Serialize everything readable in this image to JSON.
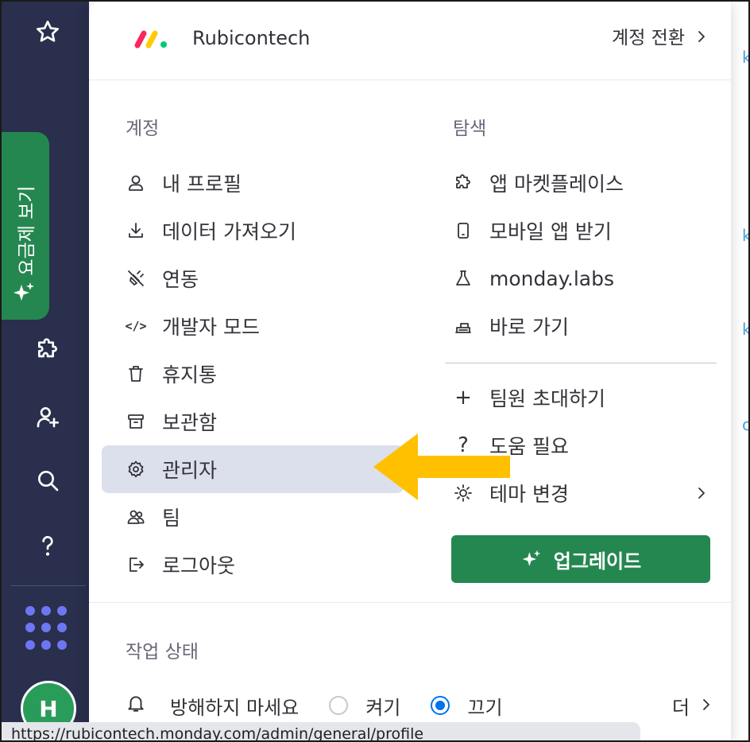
{
  "rail": {
    "plan_label": "요금제 보기",
    "avatar_initial": "H",
    "icons": [
      "star-icon",
      "puzzle-icon",
      "add-user-icon",
      "search-icon",
      "help-icon",
      "apps-grid-icon"
    ]
  },
  "header": {
    "account_name": "Rubicontech",
    "switch_account": "계정 전환"
  },
  "account_section": {
    "title": "계정",
    "items": [
      {
        "label": "내 프로필",
        "icon": "user-icon"
      },
      {
        "label": "데이터 가져오기",
        "icon": "download-icon"
      },
      {
        "label": "연동",
        "icon": "plug-icon"
      },
      {
        "label": "개발자 모드",
        "icon": "code-icon"
      },
      {
        "label": "휴지통",
        "icon": "trash-icon"
      },
      {
        "label": "보관함",
        "icon": "archive-icon"
      },
      {
        "label": "관리자",
        "icon": "gear-icon",
        "active": true
      },
      {
        "label": "팀",
        "icon": "team-icon"
      },
      {
        "label": "로그아웃",
        "icon": "logout-icon"
      }
    ]
  },
  "explore_section": {
    "title": "탐색",
    "items": [
      {
        "label": "앱 마켓플레이스",
        "icon": "puzzle-icon"
      },
      {
        "label": "모바일 앱 받기",
        "icon": "mobile-icon"
      },
      {
        "label": "monday.labs",
        "icon": "flask-icon"
      },
      {
        "label": "바로 가기",
        "icon": "keyboard-icon"
      }
    ],
    "extra_items": [
      {
        "label": "팀원 초대하기",
        "icon": "plus-icon"
      },
      {
        "label": "도움 필요",
        "icon": "question-icon"
      },
      {
        "label": "테마 변경",
        "icon": "sun-icon"
      }
    ],
    "upgrade_label": "업그레이드"
  },
  "status_section": {
    "title": "작업 상태",
    "dnd_label": "방해하지 마세요",
    "on_label": "켜기",
    "off_label": "끄기",
    "selected": "끄기",
    "more_label": "더"
  },
  "url_bar": {
    "text": "https://rubicontech.monday.com/admin/general/profile"
  },
  "colors": {
    "rail_bg": "#292f4c",
    "accent_green": "#258750",
    "active_bg": "#dcdfec",
    "arrow": "#ffc000",
    "radio_blue": "#0073ea"
  }
}
